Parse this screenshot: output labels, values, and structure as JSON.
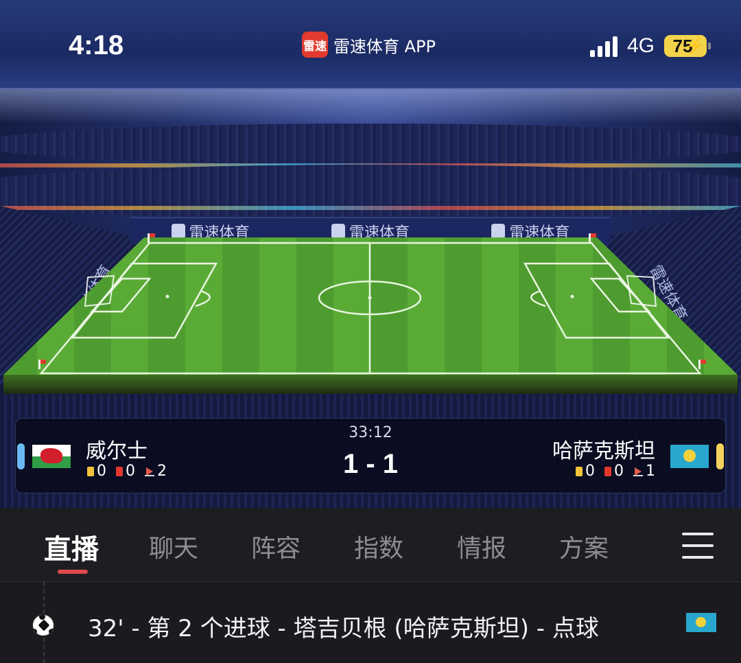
{
  "status_bar": {
    "time": "4:18",
    "app_logo_text": "雷速",
    "app_name": "雷速体育 APP",
    "network": "4G",
    "battery_level": "75",
    "signal_bars": 4
  },
  "stadium": {
    "board_text": "雷速体育"
  },
  "scoreboard": {
    "home": {
      "name": "威尔士",
      "flag": "wales-flag-icon",
      "yellow_cards": "0",
      "red_cards": "0",
      "corners": "2",
      "side_color": "#6ab9f2"
    },
    "away": {
      "name": "哈萨克斯坦",
      "flag": "kazakhstan-flag-icon",
      "yellow_cards": "0",
      "red_cards": "0",
      "corners": "1",
      "side_color": "#f4d35e"
    },
    "clock": "33:12",
    "score": "1 - 1"
  },
  "tabs": {
    "items": [
      {
        "label": "直播",
        "active": true
      },
      {
        "label": "聊天",
        "active": false
      },
      {
        "label": "阵容",
        "active": false
      },
      {
        "label": "指数",
        "active": false
      },
      {
        "label": "情报",
        "active": false
      },
      {
        "label": "方案",
        "active": false
      }
    ],
    "menu_icon": "hamburger-menu-icon",
    "accent": "#e04a4f"
  },
  "events": [
    {
      "icon": "soccer-ball-icon",
      "text": "32' - 第 2 个进球 - 塔吉贝根 (哈萨克斯坦) - 点球",
      "flag": "kazakhstan-flag-icon"
    }
  ]
}
